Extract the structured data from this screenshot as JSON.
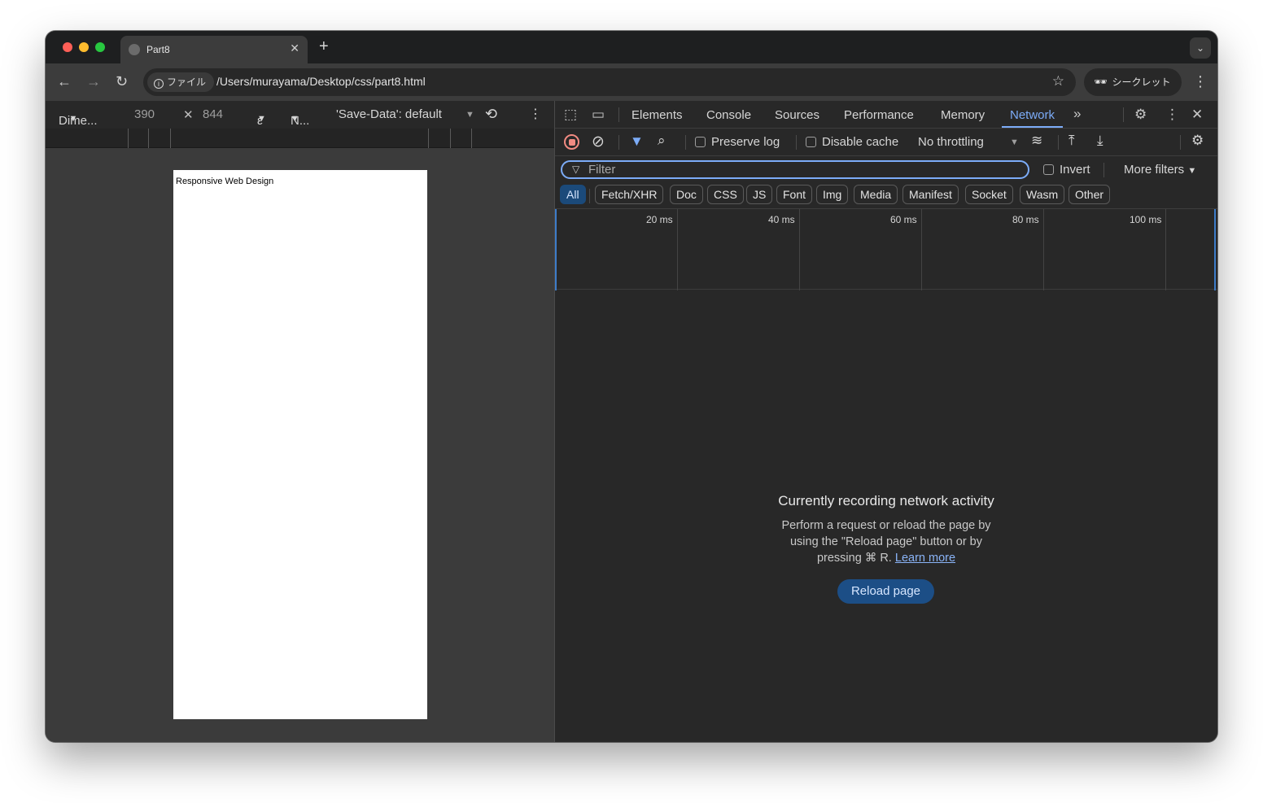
{
  "browser": {
    "tab": {
      "title": "Part8"
    },
    "address": {
      "chip_label": "ファイル",
      "url": "/Users/murayama/Desktop/css/part8.html"
    },
    "incognito_label": "シークレット"
  },
  "device_toolbar": {
    "dimensions": "Dime...",
    "width": "390",
    "height": "844",
    "scale": "ε",
    "throttle": "N...",
    "save_data": "'Save-Data': default"
  },
  "page": {
    "text": "Responsive Web Design"
  },
  "devtools": {
    "tabs": [
      "Elements",
      "Console",
      "Sources",
      "Performance",
      "Memory",
      "Network"
    ],
    "active_tab": "Network",
    "network_toolbar": {
      "preserve_log": "Preserve log",
      "disable_cache": "Disable cache",
      "throttling": "No throttling"
    },
    "filter": {
      "placeholder": "Filter",
      "invert": "Invert",
      "more_filters": "More filters"
    },
    "type_filters": [
      "All",
      "Fetch/XHR",
      "Doc",
      "CSS",
      "JS",
      "Font",
      "Img",
      "Media",
      "Manifest",
      "Socket",
      "Wasm",
      "Other"
    ],
    "timeline_ticks": [
      "20 ms",
      "40 ms",
      "60 ms",
      "80 ms",
      "100 ms"
    ],
    "empty_state": {
      "title": "Currently recording network activity",
      "body_line1": "Perform a request or reload the page by",
      "body_line2": "using the \"Reload page\" button or by",
      "body_line3": "pressing ⌘ R.",
      "learn_more": "Learn more",
      "reload_button": "Reload page"
    }
  },
  "colors": {
    "accent": "#7cacf8",
    "record": "#f28b82",
    "primary_button": "#1c4e86"
  }
}
